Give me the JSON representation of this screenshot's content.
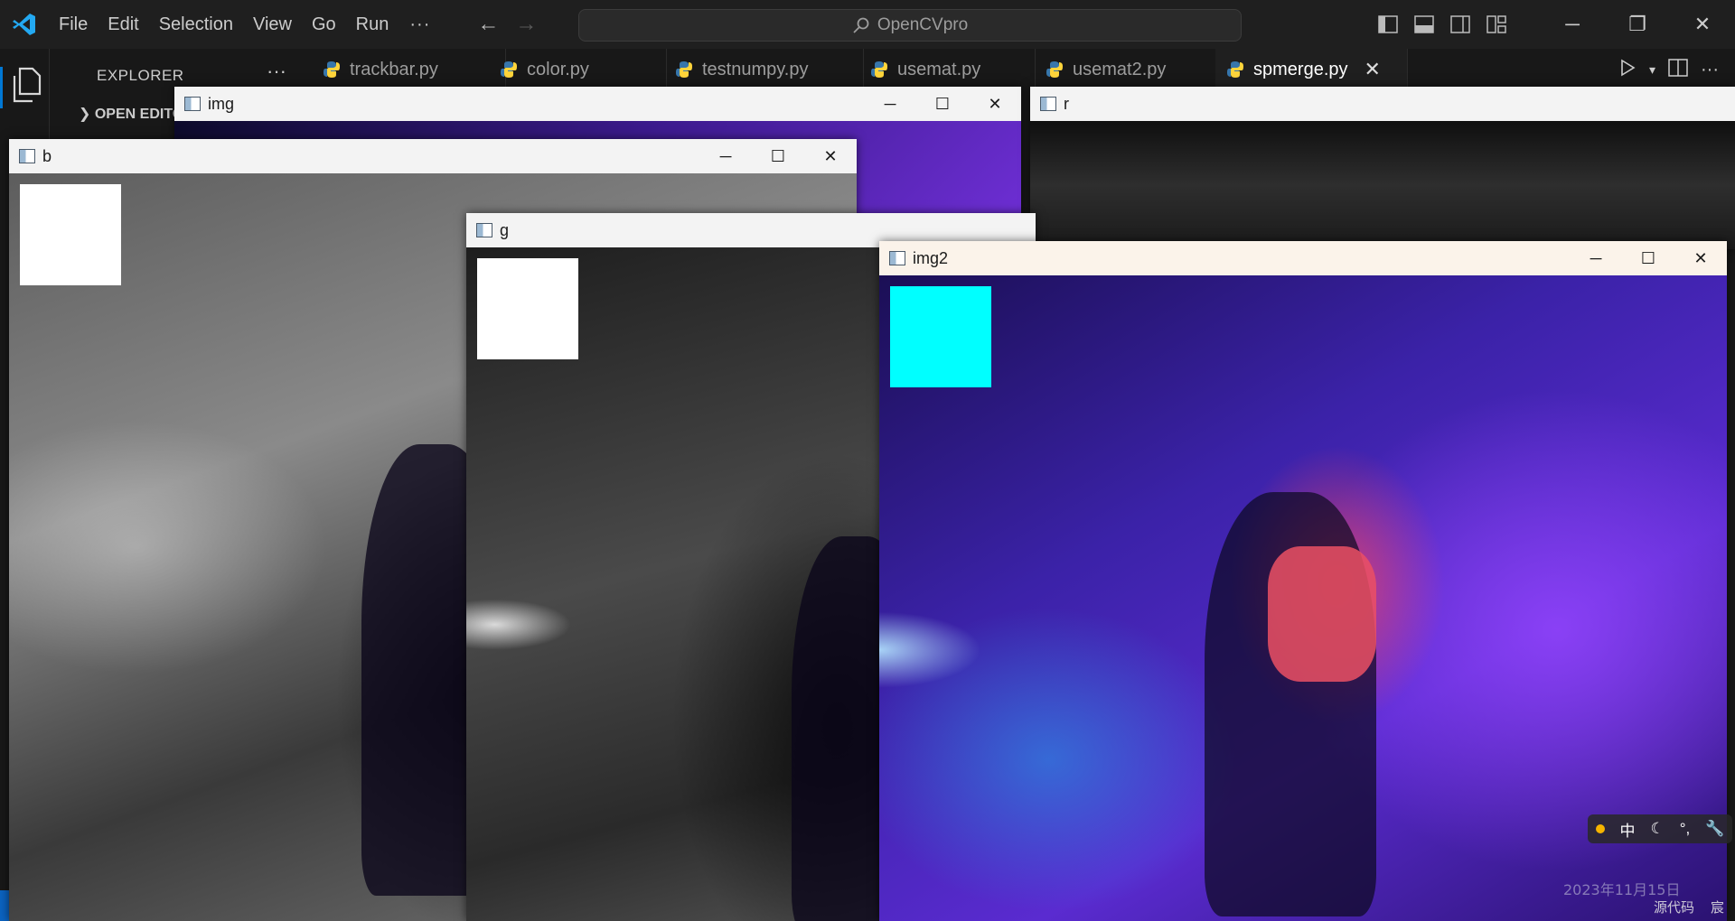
{
  "menu": [
    "File",
    "Edit",
    "Selection",
    "View",
    "Go",
    "Run"
  ],
  "menu_more": "···",
  "search": {
    "text": "OpenCVpro"
  },
  "sidebar": {
    "title": "EXPLORER",
    "dots": "···",
    "open_editors": "OPEN EDITORS"
  },
  "tabs": [
    {
      "label": "trackbar.py",
      "active": false
    },
    {
      "label": "color.py",
      "active": false
    },
    {
      "label": "testnumpy.py",
      "active": false
    },
    {
      "label": "usemat.py",
      "active": false
    },
    {
      "label": "usemat2.py",
      "active": false
    },
    {
      "label": "spmerge.py",
      "active": true
    }
  ],
  "windows": {
    "img": {
      "title": "img"
    },
    "r": {
      "title": "r"
    },
    "b": {
      "title": "b",
      "swatch_color": "#ffffff"
    },
    "g": {
      "title": "g",
      "swatch_color": "#ffffff"
    },
    "img2": {
      "title": "img2",
      "swatch_color": "#00ffff"
    }
  },
  "ime": {
    "lang": "中"
  },
  "watermark": {
    "date": "2023年11月15日",
    "source": "源代码",
    "name": "宸"
  },
  "colors": {
    "accent": "#0078d4",
    "vscode_logo": "#23a9f2",
    "python_blue": "#3776ab",
    "python_yellow": "#ffd43b"
  }
}
